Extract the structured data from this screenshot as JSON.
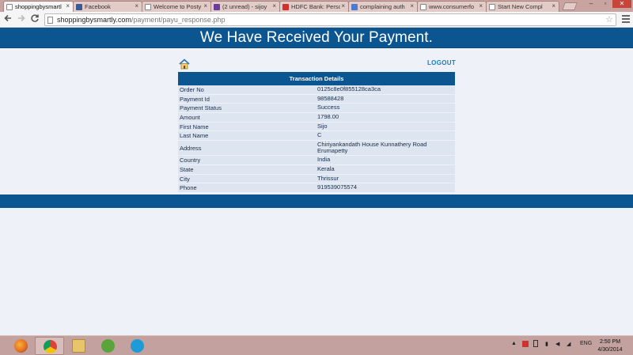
{
  "browser": {
    "tabs": [
      {
        "label": "shoppingbysmartl",
        "favicon_color": "#ffffff",
        "active": true
      },
      {
        "label": "Facebook",
        "favicon_color": "#3b5998",
        "active": false
      },
      {
        "label": "Welcome to Posty",
        "favicon_color": "#ffffff",
        "active": false
      },
      {
        "label": "(2 unread) - sijoy",
        "favicon_color": "#6a3d9a",
        "active": false
      },
      {
        "label": "HDFC Bank: Perso",
        "favicon_color": "#d32f2f",
        "active": false
      },
      {
        "label": "complaining auth",
        "favicon_color": "#4a7bd0",
        "active": false
      },
      {
        "label": "www.consumerfo",
        "favicon_color": "#ffffff",
        "active": false
      },
      {
        "label": "Start New Compl",
        "favicon_color": "#ffffff",
        "active": false
      }
    ],
    "tab_close_glyph": "×",
    "url_host": "shoppingbysmartly.com",
    "url_path": "/payment/payu_response.php",
    "window_controls": {
      "minimize": "–",
      "maximize": "▫",
      "close": "✕"
    }
  },
  "page": {
    "header_title": "We Have Received Your Payment.",
    "logout_label": "LOGOUT",
    "table_title": "Transaction Details",
    "rows": [
      {
        "label": "Order No",
        "value": "0125c8e0f855128ca3ca"
      },
      {
        "label": "Payment Id",
        "value": "98588428"
      },
      {
        "label": "Payment Status",
        "value": "Success"
      },
      {
        "label": "Amount",
        "value": "1798.00"
      },
      {
        "label": "First Name",
        "value": "Sijo"
      },
      {
        "label": "Last Name",
        "value": "C"
      },
      {
        "label": "Address",
        "value": "Chiriyankandath House Kunnathery Road Erumapetty"
      },
      {
        "label": "Country",
        "value": "India"
      },
      {
        "label": "State",
        "value": "Kerala"
      },
      {
        "label": "City",
        "value": "Thrissur"
      },
      {
        "label": "Phone",
        "value": "919539075574"
      }
    ]
  },
  "taskbar": {
    "apps": [
      {
        "name": "firefox-icon",
        "color": "#e66a1f",
        "running": false
      },
      {
        "name": "chrome-icon",
        "color": "#3a9d3f",
        "running": true
      },
      {
        "name": "explorer-icon",
        "color": "#e8c56a",
        "running": false
      },
      {
        "name": "utorrent-icon",
        "color": "#5aa43c",
        "running": false
      },
      {
        "name": "skype-icon",
        "color": "#1d9bd7",
        "running": false
      }
    ],
    "language": "ENG",
    "time": "2:50 PM",
    "date": "4/30/2014"
  }
}
